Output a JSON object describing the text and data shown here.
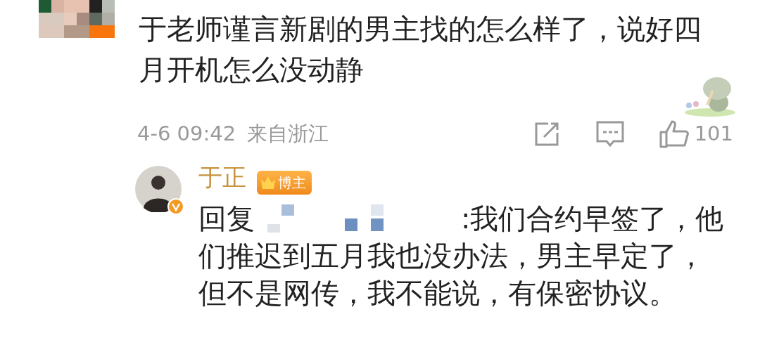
{
  "comment": {
    "lines": [
      "于老师谨言新剧的男主找的怎么样了，说好四",
      "月开机怎么没动静"
    ],
    "time": "4-6 09:42",
    "location": "来自浙江",
    "likes": "101"
  },
  "reply": {
    "author": "于正",
    "badge": "博主",
    "verified": true,
    "prefix": "回复",
    "lines": [
      ":我们合约早签了，他",
      "们推迟到五月我也没办法，男主早定了，",
      "但不是网传，我不能说，有保密协议。"
    ]
  }
}
